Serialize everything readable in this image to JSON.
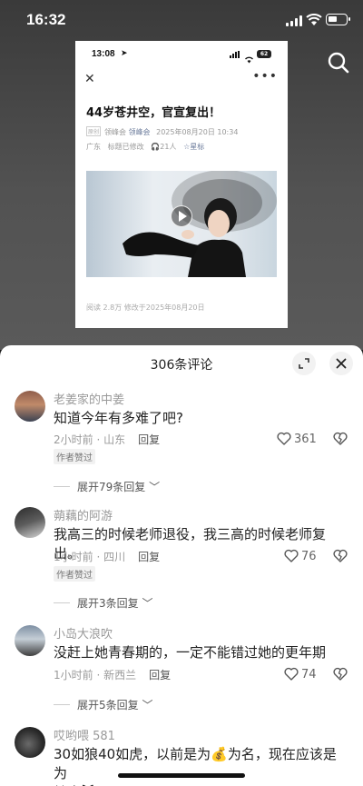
{
  "status_bar": {
    "time": "16:32"
  },
  "article_card": {
    "status_time": "13:08",
    "battery": "62",
    "title": "44岁苍井空，官宣复出！",
    "tag": "原创",
    "source": "领峰会",
    "author": "领峰会",
    "datetime": "2025年08月20日 10:34",
    "region": "广东",
    "edited": "标题已修改",
    "listeners": "21人",
    "star_label": "星标",
    "footer": "阅读 2.8万   修改于2025年08月20日"
  },
  "sheet": {
    "title": "306条评论"
  },
  "comments": [
    {
      "name": "老姜家的中姜",
      "text": "知道今年有多难了吧?",
      "time_location": "2小时前 · 山东",
      "reply": "回复",
      "badge": "作者赞过",
      "likes": "361",
      "expand": "展开79条回复"
    },
    {
      "name": "蒴藕的阿游",
      "text": "我高三的时候老师退役，我三高的时候老师复出。",
      "time_location": "1小时前 · 四川",
      "reply": "回复",
      "badge": "作者赞过",
      "likes": "76",
      "expand": "展开3条回复"
    },
    {
      "name": "小岛大浪吹",
      "text": "没赶上她青春期的，一定不能错过她的更年期",
      "time_location": "1小时前 · 新西兰",
      "reply": "回复",
      "likes": "74",
      "expand": "展开5条回复"
    },
    {
      "name": "哎哟喂 581",
      "text_part1": "30如狼40如虎，以前是为",
      "text_part2": "为名，现在应该是为",
      "text_part3": "健康"
    }
  ],
  "icons": {
    "search": "search-icon",
    "expand": "expand-icon",
    "close": "close-icon",
    "heart": "heart-icon",
    "broken_heart": "broken-heart-icon",
    "chevron": "chevron-down-icon",
    "money_bag": "money-bag-icon",
    "cat": "cat-face-icon"
  }
}
